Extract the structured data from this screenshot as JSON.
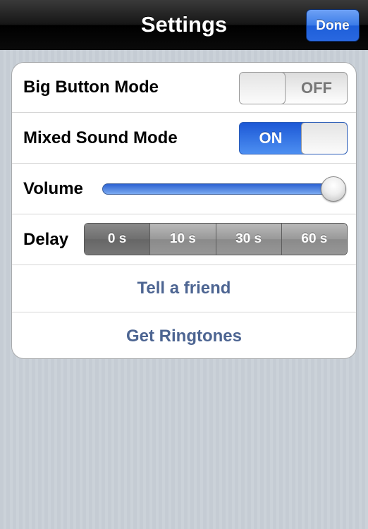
{
  "navbar": {
    "title": "Settings",
    "done_label": "Done"
  },
  "settings": {
    "big_button_mode": {
      "label": "Big Button Mode",
      "state": "OFF"
    },
    "mixed_sound_mode": {
      "label": "Mixed Sound Mode",
      "state": "ON"
    },
    "volume": {
      "label": "Volume",
      "value": 1.0
    },
    "delay": {
      "label": "Delay",
      "options": [
        "0 s",
        "10 s",
        "30 s",
        "60 s"
      ],
      "selected": "0 s"
    },
    "tell_friend_label": "Tell a friend",
    "get_ringtones_label": "Get Ringtones"
  },
  "colors": {
    "accent_blue": "#2b6ee3",
    "link_text": "#4d6592",
    "background": "#c5ccd4"
  }
}
